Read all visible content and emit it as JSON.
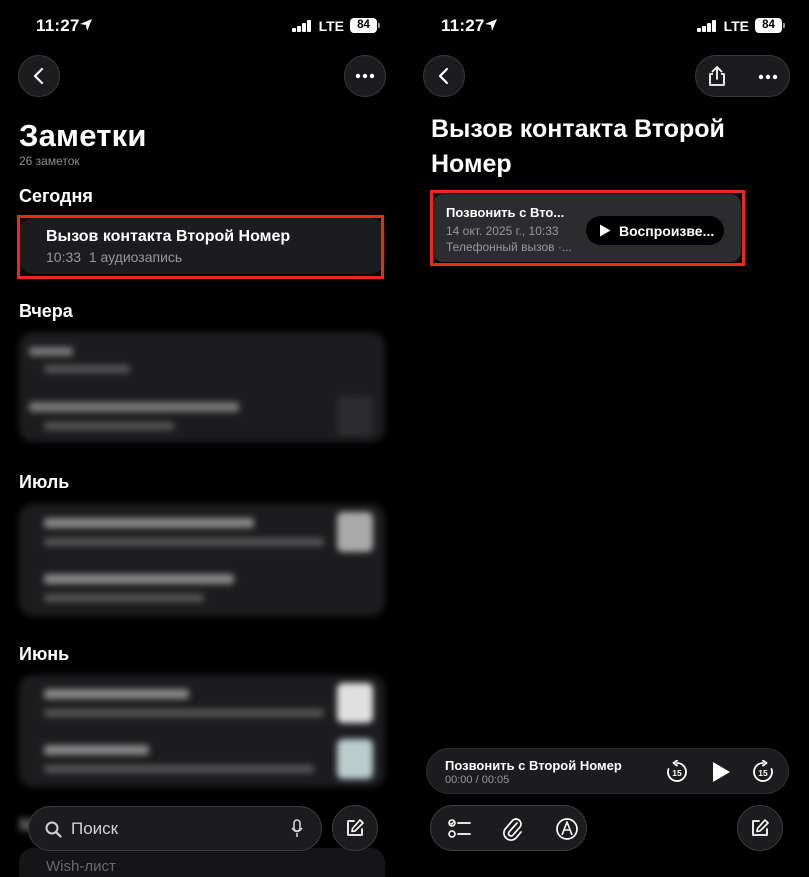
{
  "left": {
    "status": {
      "time": "11:27",
      "network": "LTE",
      "battery": "84"
    },
    "title": "Заметки",
    "count": "26 заметок",
    "sections": {
      "today": "Сегодня",
      "yesterday": "Вчера",
      "july": "Июль",
      "june": "Июнь",
      "partial": "Ма"
    },
    "today_note": {
      "title": "Вызов контакта Второй Номер",
      "time": "10:33",
      "meta": "1 аудиозапись"
    },
    "search_placeholder": "Поиск",
    "bottom_partial_note": "Wish-лист"
  },
  "right": {
    "status": {
      "time": "11:27",
      "network": "LTE",
      "battery": "84"
    },
    "note_title": "Вызов контакта Второй Номер",
    "audio": {
      "title": "Позвонить с Вто...",
      "date": "14 окт. 2025 г., 10:33",
      "kind": "Телефонный вызов ·...",
      "play_label": "Воспроизве..."
    },
    "player": {
      "title": "Позвонить с Второй Номер",
      "progress": "00:00 / 00:05",
      "skip_back": "15",
      "skip_forward": "15"
    }
  },
  "colors": {
    "highlight": "#e8291c",
    "card": "#1c1c1e",
    "background": "#000000"
  }
}
